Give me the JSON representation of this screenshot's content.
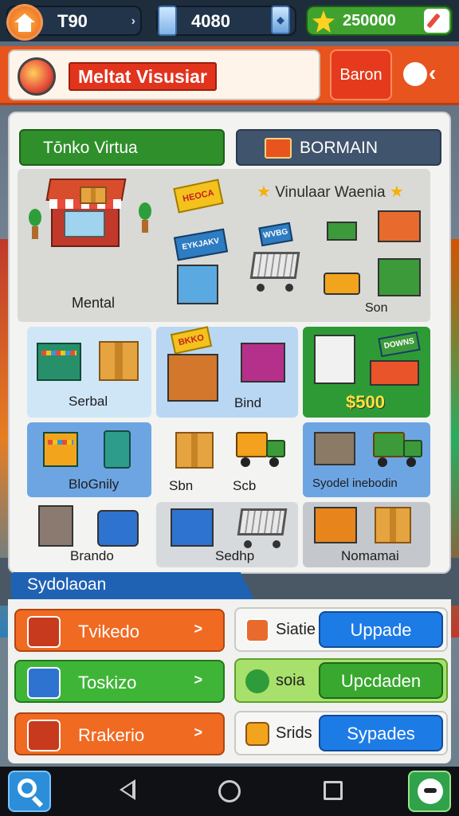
{
  "topbar": {
    "level_value": "T90",
    "gems_value": "4080",
    "cash_value": "250000",
    "colors": {
      "bar": "#1e2d3c",
      "cash": "#3fa22f"
    }
  },
  "header": {
    "title": "Meltat Visusiar",
    "button_label": "Baron",
    "colors": {
      "bg": "#e8541e",
      "title_bg": "#e2331d"
    }
  },
  "tabs": [
    {
      "label": "Tōnko Virtua",
      "color": "#2f8f2a"
    },
    {
      "label": "BORMAIN",
      "color": "#40546d"
    }
  ],
  "showcase": {
    "title": "Vinulaar Waenia",
    "label_left": "Mental",
    "label_right": "Son",
    "sign_texts": [
      "HEOCA",
      "EYKJAKV",
      "WVBG"
    ]
  },
  "tiles": [
    {
      "label": "Serbal",
      "bg": "#cfe6f7"
    },
    {
      "label": "Bind",
      "bg": "#b9d7f2"
    },
    {
      "label": "$500",
      "bg": "#2e9a36",
      "sign": "DOWNS"
    },
    {
      "label": "BloGnily",
      "bg": "#6da5e3"
    },
    {
      "label": "Sbn",
      "bg": "#f3f3f1"
    },
    {
      "label": "Scb",
      "bg": "#f3f3f1"
    },
    {
      "label": "Syodel inebodin",
      "bg": "#6da5e3"
    },
    {
      "label": "Brando",
      "bg": "#f3f3f1"
    },
    {
      "label": "Sedhp",
      "bg": "#d7dadc"
    },
    {
      "label": "Nomamai",
      "bg": "#c4c8cc"
    }
  ],
  "section": {
    "title": "Sydolaoan",
    "actions": [
      {
        "label": "Tvikedo",
        "go": ">",
        "color": "#f16a22"
      },
      {
        "label": "Toskizo",
        "go": ">",
        "color": "#3fb537"
      },
      {
        "label": "Rrakerio",
        "go": ">",
        "color": "#f16a22"
      }
    ],
    "cards": [
      {
        "label": "Siatie",
        "button": "Uppade",
        "button_color": "#1d7be6"
      },
      {
        "label": "soia",
        "button": "Upcdaden",
        "button_color": "#38a82f"
      },
      {
        "label": "Srids",
        "button": "Sypades",
        "button_color": "#1d7be6"
      }
    ]
  },
  "navbar": {
    "icons": [
      "search-app-icon",
      "back-icon",
      "home-icon",
      "recent-apps-icon",
      "chat-app-icon"
    ]
  }
}
